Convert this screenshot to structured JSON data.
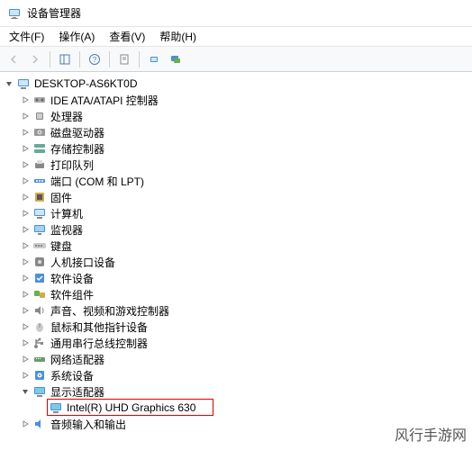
{
  "window": {
    "title": "设备管理器"
  },
  "menu": {
    "file": "文件(F)",
    "actions": "操作(A)",
    "view": "查看(V)",
    "help": "帮助(H)"
  },
  "tree": {
    "root": "DESKTOP-AS6KT0D",
    "categories": [
      {
        "label": "IDE ATA/ATAPI 控制器",
        "icon": "ide"
      },
      {
        "label": "处理器",
        "icon": "cpu"
      },
      {
        "label": "磁盘驱动器",
        "icon": "disk"
      },
      {
        "label": "存储控制器",
        "icon": "storage"
      },
      {
        "label": "打印队列",
        "icon": "printer"
      },
      {
        "label": "端口 (COM 和 LPT)",
        "icon": "port"
      },
      {
        "label": "固件",
        "icon": "firmware"
      },
      {
        "label": "计算机",
        "icon": "computer"
      },
      {
        "label": "监视器",
        "icon": "monitor"
      },
      {
        "label": "键盘",
        "icon": "keyboard"
      },
      {
        "label": "人机接口设备",
        "icon": "hid"
      },
      {
        "label": "软件设备",
        "icon": "software"
      },
      {
        "label": "软件组件",
        "icon": "swcomp"
      },
      {
        "label": "声音、视频和游戏控制器",
        "icon": "audio"
      },
      {
        "label": "鼠标和其他指针设备",
        "icon": "mouse"
      },
      {
        "label": "通用串行总线控制器",
        "icon": "usb"
      },
      {
        "label": "网络适配器",
        "icon": "network"
      },
      {
        "label": "系统设备",
        "icon": "system"
      },
      {
        "label": "显示适配器",
        "icon": "display",
        "expanded": true,
        "children": [
          {
            "label": "Intel(R) UHD Graphics 630",
            "icon": "display",
            "highlighted": true
          }
        ]
      },
      {
        "label": "音频输入和输出",
        "icon": "audioio"
      }
    ]
  },
  "watermark": "风行手游网"
}
